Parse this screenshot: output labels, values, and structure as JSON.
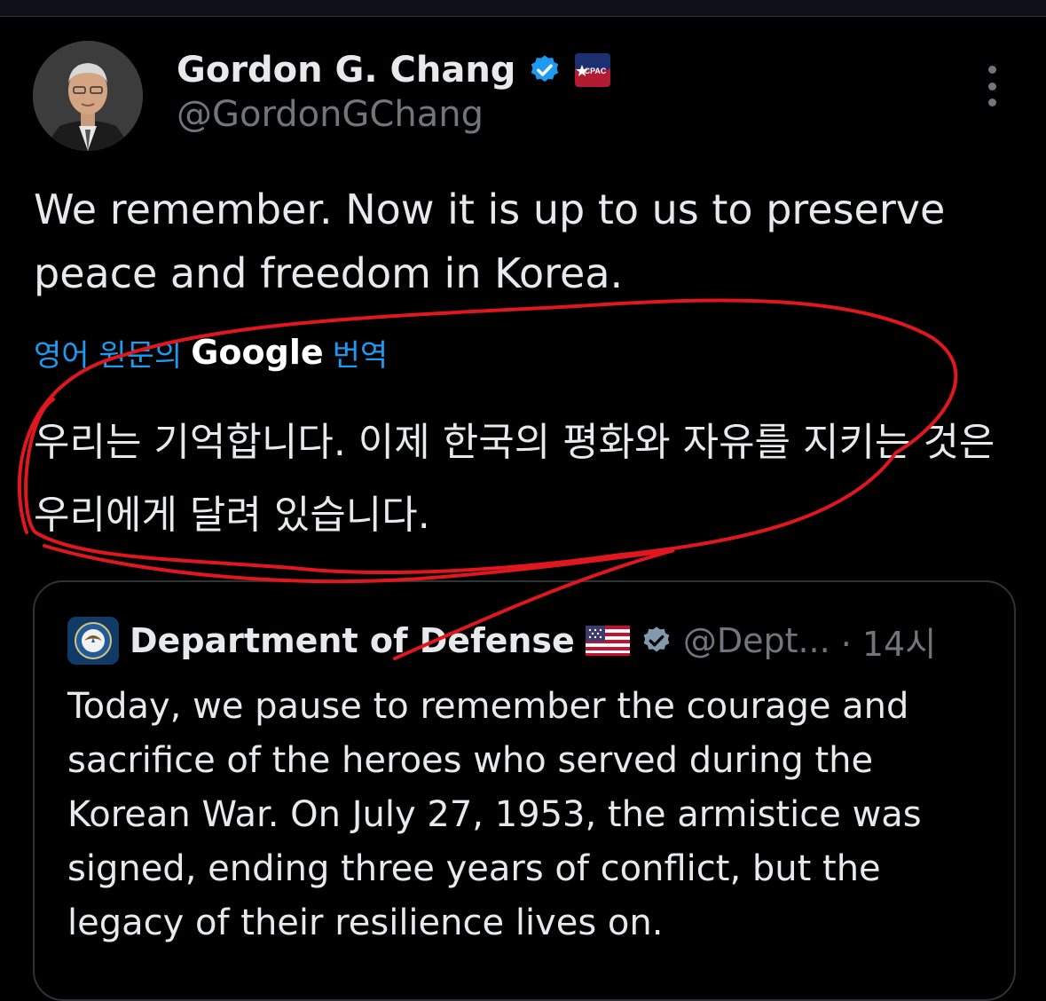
{
  "author": {
    "name": "Gordon G. Chang",
    "handle": "@GordonGChang",
    "badge_text": "CPAC"
  },
  "tweet": {
    "text": "We remember. Now it is up to us to preserve peace and freedom in Korea."
  },
  "translation": {
    "label": "영어 원문의",
    "provider": "Google",
    "suffix": "번역",
    "text": "우리는 기억합니다. 이제 한국의 평화와 자유를 지키는 것은 우리에게 달려 있습니다."
  },
  "quoted_post": {
    "name": "Department of Defense",
    "handle": "@Dept...",
    "time": "· 14시",
    "text": "Today, we pause to remember the courage and sacrifice of the heroes who served during the Korean War. On July 27, 1953, the armistice was signed, ending three years of conflict, but the legacy of their resilience lives on."
  },
  "colors": {
    "background": "#000000",
    "verified": "#1d9bf0",
    "link": "#1d9bf0",
    "annotation": "#e0171e"
  },
  "icons": {
    "verified": "verified-badge-icon",
    "more": "more-options-icon",
    "flag": "us-flag-icon",
    "gov_badge": "government-badge-icon"
  }
}
